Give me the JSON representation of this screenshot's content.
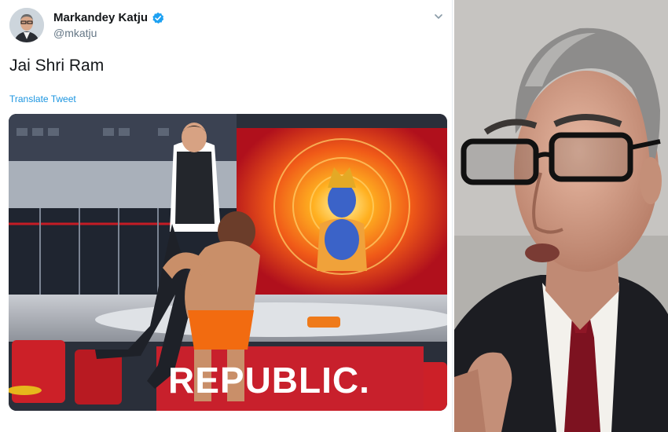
{
  "tweet": {
    "display_name": "Markandey Katju",
    "handle": "@mkatju",
    "verified": true,
    "text": "Jai Shri Ram",
    "translate_label": "Translate Tweet",
    "menu_icon": "chevron-down-icon"
  },
  "media": {
    "logo_text": "REPUBLIC.",
    "icon": "photo"
  },
  "colors": {
    "link": "#1b95e0",
    "verified_badge": "#1da1f2",
    "studio_red": "#c8202c"
  }
}
